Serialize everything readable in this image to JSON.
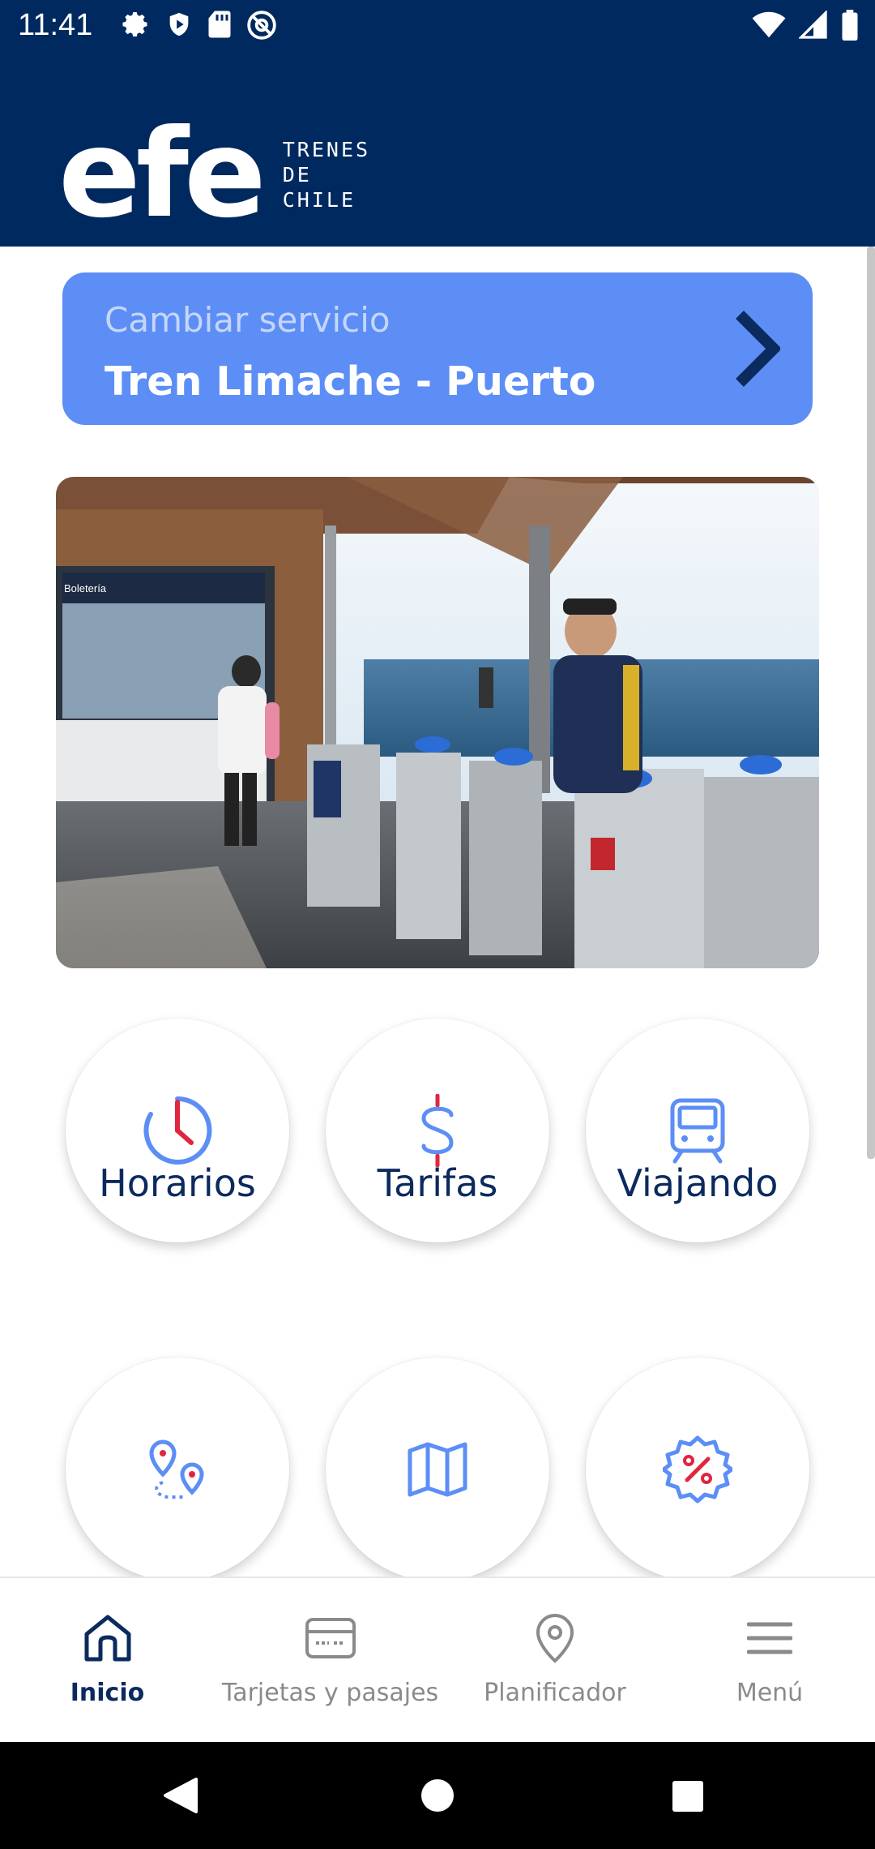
{
  "status_bar": {
    "time": "11:41"
  },
  "header": {
    "logo_text": "efe",
    "logo_subtitle": [
      "TRENES",
      "DE",
      "CHILE"
    ]
  },
  "service": {
    "label": "Cambiar servicio",
    "value": "Tren Limache - Puerto"
  },
  "tiles": [
    {
      "label": "Horarios",
      "icon": "clock-icon"
    },
    {
      "label": "Tarifas",
      "icon": "dollar-icon"
    },
    {
      "label": "Viajando",
      "icon": "train-icon"
    },
    {
      "label": "",
      "icon": "route-icon"
    },
    {
      "label": "",
      "icon": "map-icon"
    },
    {
      "label": "",
      "icon": "discount-icon"
    }
  ],
  "bottom_nav": [
    {
      "label": "Inicio",
      "icon": "home-icon",
      "active": true
    },
    {
      "label": "Tarjetas y pasajes",
      "icon": "card-icon",
      "active": false
    },
    {
      "label": "Planificador",
      "icon": "location-pin-icon",
      "active": false
    },
    {
      "label": "Menú",
      "icon": "menu-icon",
      "active": false
    }
  ],
  "colors": {
    "header_bg": "#00295f",
    "accent_blue": "#5c8ef6",
    "accent_red": "#e0263f",
    "text_navy": "#0b2a5e"
  }
}
